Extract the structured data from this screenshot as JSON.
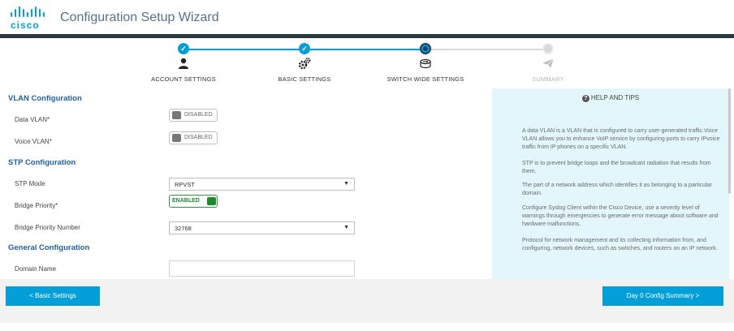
{
  "header": {
    "logo_text": "cisco",
    "title": "Configuration Setup Wizard",
    "brand_color": "#049fd9",
    "bar_color": "#2b3a42"
  },
  "stepper": {
    "steps": [
      {
        "label": "ACCOUNT SETTINGS",
        "status": "done",
        "icon": "user-icon"
      },
      {
        "label": "BASIC SETTINGS",
        "status": "done",
        "icon": "gears-icon"
      },
      {
        "label": "SWITCH WIDE SETTINGS",
        "status": "current",
        "icon": "switch-icon"
      },
      {
        "label": "SUMMARY",
        "status": "todo",
        "icon": "paper-plane-icon"
      }
    ]
  },
  "vlan": {
    "title": "VLAN Configuration",
    "data_vlan_label": "Data VLAN*",
    "data_vlan_state": "DISABLED",
    "voice_vlan_label": "Voice VLAN*",
    "voice_vlan_state": "DISABLED"
  },
  "stp": {
    "title": "STP Configuration",
    "mode_label": "STP Mode",
    "mode_value": "RPVST",
    "priority_label": "Bridge Priority*",
    "priority_state": "ENABLED",
    "priority_number_label": "Bridge Priority Number",
    "priority_number_value": "32768"
  },
  "general": {
    "title": "General Configuration",
    "domain_label": "Domain Name",
    "domain_value": ""
  },
  "help": {
    "title": "HELP AND TIPS",
    "paragraphs": [
      "A data VLAN is a VLAN that is configured to carry user-generated traffic.Voice VLAN allows you to enhance VoIP service by configuring ports to carry IPvoice traffic from IP phones on a specific VLAN.",
      "STP is to prevent bridge loops and the broadcast radiation that results from them.",
      "The part of a network address which identifies it as belonging to a particular domain.",
      "Configure Syslog Client within the Cisco Device, use a severity level of warnings through emergencies to generate error message about software and hardware malfunctions.",
      "Protocol for network management and its collecting information from, and configuring, network devices, such as switches, and routers on an IP network."
    ]
  },
  "buttons": {
    "back": "< Basic Settings",
    "next": "Day 0 Config Summary >"
  }
}
